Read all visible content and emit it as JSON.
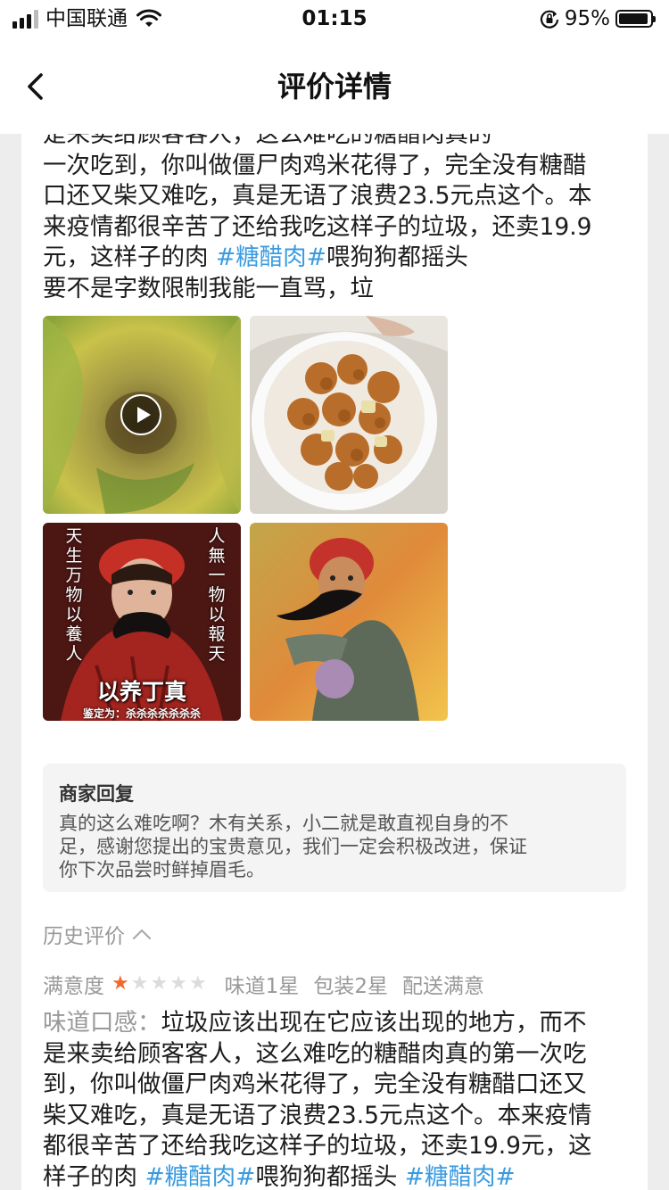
{
  "status_bar": {
    "carrier": "中国联通",
    "time": "01:15",
    "battery_percent": "95%",
    "battery_level": 0.95,
    "icons": [
      "signal-icon",
      "wifi-icon",
      "rotation-lock-icon",
      "battery-icon"
    ]
  },
  "nav": {
    "title": "评价详情",
    "back_icon": "chevron-left-icon"
  },
  "review": {
    "lines": [
      "是来卖给顾客客人，这么难吃的糖醋肉真的",
      "一次吃到，你叫做僵尸肉鸡米花得了，完全没有糖醋",
      "口还又柴又难吃，真是无语了浪费23.5元点这个。本",
      "来疫情都很辛苦了还给我吃这样子的垃圾，还卖19.9"
    ],
    "line5_before": "元，这样子的肉 ",
    "line5_tag": "#糖醋肉#",
    "line5_after": "喂狗狗都摇头",
    "line6": "要不是字数限制我能一直骂，垃",
    "photos": [
      {
        "type": "video",
        "content": "video thumbnail of food in a plastic bag"
      },
      {
        "type": "image",
        "content": "fried pork pieces in a white bowl"
      },
      {
        "type": "image",
        "content": "meme",
        "caption": "以养丁真",
        "subcaption": "鉴定为：杀杀杀杀杀杀杀",
        "left_vertical": "天生万物以養人",
        "right_vertical": "人無一物以報天"
      },
      {
        "type": "image",
        "content": "meme character with red hat punching"
      }
    ]
  },
  "merchant_reply": {
    "title": "商家回复",
    "lines": [
      "真的这么难吃啊？木有关系，小二就是敢直视自身的不",
      "足，感谢您提出的宝贵意见，我们一定会积极改进，保证",
      "你下次品尝时鲜掉眉毛。"
    ]
  },
  "history": {
    "label": "历史评价",
    "toggle_icon": "chevron-up-icon",
    "satisfaction_label": "满意度",
    "stars_filled": 1,
    "stars_total": 5,
    "taste": "味道1星",
    "packaging": "包装2星",
    "delivery": "配送满意",
    "text_label": "味道口感：",
    "lines": [
      "垃圾应该出现在它应该出现的地方，而不",
      "是来卖给顾客客人，这么难吃的糖醋肉真的第一次吃",
      "到，你叫做僵尸肉鸡米花得了，完全没有糖醋口还又",
      "柴又难吃，真是无语了浪费23.5元点这个。本来疫情",
      "都很辛苦了还给我吃这样子的垃圾，还卖19.9元，这"
    ],
    "last_line_before": "样子的肉 ",
    "last_line_tag1": "#糖醋肉#",
    "last_line_middle": "喂狗狗都摇头 ",
    "last_line_tag2": "#糖醋肉#"
  },
  "colors": {
    "tag": "#3a9be0",
    "star_on": "#f2692d",
    "star_off": "#dcdcdc",
    "muted_text": "#999999",
    "page_background": "#ededed"
  }
}
